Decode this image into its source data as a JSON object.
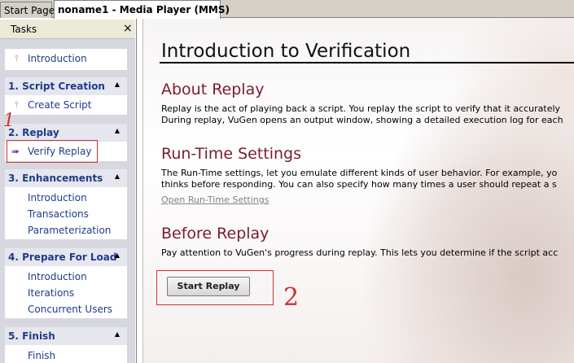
{
  "tabs": [
    {
      "label": "Start Page"
    },
    {
      "label": "noname1 - Media Player (MMS)"
    }
  ],
  "sidebar": {
    "title": "Tasks",
    "close_glyph": "×",
    "intro": "Introduction",
    "sections": [
      {
        "title": "1. Script Creation",
        "items": [
          "Create Script"
        ]
      },
      {
        "title": "2. Replay",
        "items": [
          "Verify Replay"
        ]
      },
      {
        "title": "3. Enhancements",
        "items": [
          "Introduction",
          "Transactions",
          "Parameterization"
        ]
      },
      {
        "title": "4. Prepare For Load",
        "items": [
          "Introduction",
          "Iterations",
          "Concurrent Users"
        ]
      },
      {
        "title": "5. Finish",
        "items": [
          "Finish"
        ]
      }
    ]
  },
  "annotations": {
    "mark1": "1",
    "mark2": "2"
  },
  "main": {
    "title": "Introduction to Verification",
    "about_heading": "About Replay",
    "about_line1": "Replay is the act of playing back a script. You replay the script to verify that it accurately",
    "about_line2": "During replay, VuGen opens an output window, showing a detailed execution log for each",
    "rts_heading": "Run-Time Settings",
    "rts_line1": "The Run-Time settings, let you emulate different kinds of user behavior. For example, yo",
    "rts_line2": "thinks before responding. You can also specify how many times a user should repeat a s",
    "rts_link": "Open Run-Time Settings",
    "before_heading": "Before Replay",
    "before_line1": "Pay attention to VuGen's progress during replay. This lets you determine if the script acc",
    "start_button": "Start Replay"
  },
  "colors": {
    "heading": "#7a1c2e",
    "nav_link": "#1f3c88",
    "annotation": "#d03030"
  }
}
